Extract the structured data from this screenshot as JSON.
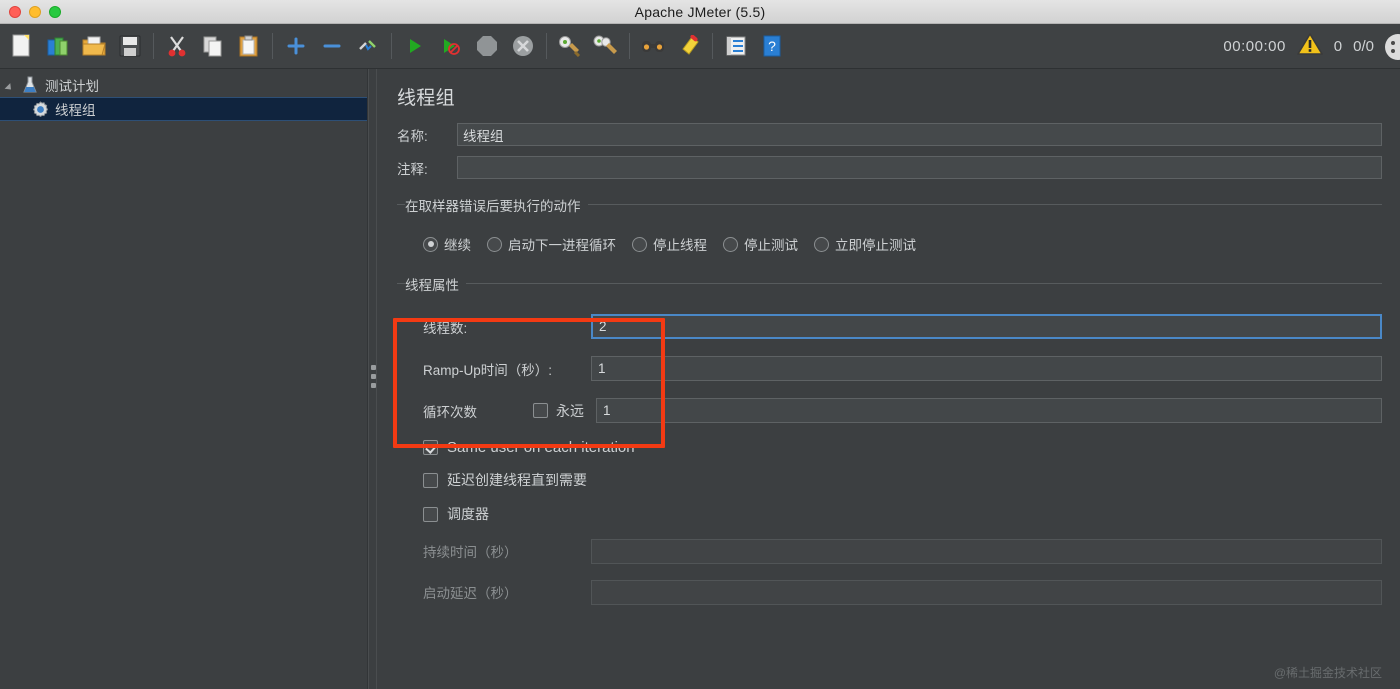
{
  "window": {
    "title": "Apache JMeter (5.5)",
    "traffic_lights": [
      "close",
      "minimize",
      "maximize"
    ]
  },
  "toolbar": {
    "icons": [
      {
        "name": "new-icon",
        "label": "New"
      },
      {
        "name": "templates-icon",
        "label": "Templates"
      },
      {
        "name": "open-icon",
        "label": "Open"
      },
      {
        "name": "save-icon",
        "label": "Save"
      },
      {
        "name": "cut-icon",
        "label": "Cut"
      },
      {
        "name": "copy-icon",
        "label": "Copy"
      },
      {
        "name": "paste-icon",
        "label": "Paste"
      },
      {
        "name": "expand-all-icon",
        "label": "Expand All"
      },
      {
        "name": "collapse-all-icon",
        "label": "Collapse All"
      },
      {
        "name": "toggle-icon",
        "label": "Toggle"
      },
      {
        "name": "start-icon",
        "label": "Start"
      },
      {
        "name": "start-no-pause-icon",
        "label": "Start no pauses"
      },
      {
        "name": "stop-icon",
        "label": "Stop"
      },
      {
        "name": "shutdown-icon",
        "label": "Shutdown"
      },
      {
        "name": "clear-icon",
        "label": "Clear"
      },
      {
        "name": "clear-all-icon",
        "label": "Clear All"
      },
      {
        "name": "search-icon",
        "label": "Search"
      },
      {
        "name": "reset-search-icon",
        "label": "Reset Search"
      },
      {
        "name": "function-helper-icon",
        "label": "Function Helper Dialog"
      },
      {
        "name": "help-icon",
        "label": "Help"
      }
    ],
    "timer": "00:00:00",
    "error_count": "0",
    "thread_count": "0/0"
  },
  "tree": {
    "items": [
      {
        "label": "测试计划",
        "icon": "test-plan-icon",
        "selected": false,
        "level": 0,
        "expanded": true
      },
      {
        "label": "线程组",
        "icon": "thread-group-icon",
        "selected": true,
        "level": 1
      }
    ]
  },
  "main": {
    "panel_title": "线程组",
    "name_label": "名称:",
    "name_value": "线程组",
    "comment_label": "注释:",
    "comment_value": "",
    "error_action": {
      "group_title": "在取样器错误后要执行的动作",
      "options": [
        {
          "label": "继续",
          "selected": true
        },
        {
          "label": "启动下一进程循环",
          "selected": false
        },
        {
          "label": "停止线程",
          "selected": false
        },
        {
          "label": "停止测试",
          "selected": false
        },
        {
          "label": "立即停止测试",
          "selected": false
        }
      ]
    },
    "thread_properties": {
      "group_title": "线程属性",
      "num_threads_label": "线程数:",
      "num_threads_value": "2",
      "ramp_up_label": "Ramp-Up时间（秒）:",
      "ramp_up_value": "1",
      "loop_count_label": "循环次数",
      "loop_forever_label": "永远",
      "loop_forever_checked": false,
      "loop_count_value": "1",
      "same_user_label": "Same user on each iteration",
      "same_user_checked": true,
      "delay_thread_label": "延迟创建线程直到需要",
      "delay_thread_checked": false,
      "scheduler_label": "调度器",
      "scheduler_checked": false,
      "duration_label": "持续时间（秒）",
      "duration_value": "",
      "startup_delay_label": "启动延迟（秒）",
      "startup_delay_value": ""
    }
  },
  "watermark": "@稀土掘金技术社区",
  "colors": {
    "background": "#3c3f41",
    "panel": "#3f4244",
    "selection": "#10243e",
    "focus_border": "#4a88c7",
    "annotation": "#f33a13",
    "text": "#cdd0d2"
  }
}
